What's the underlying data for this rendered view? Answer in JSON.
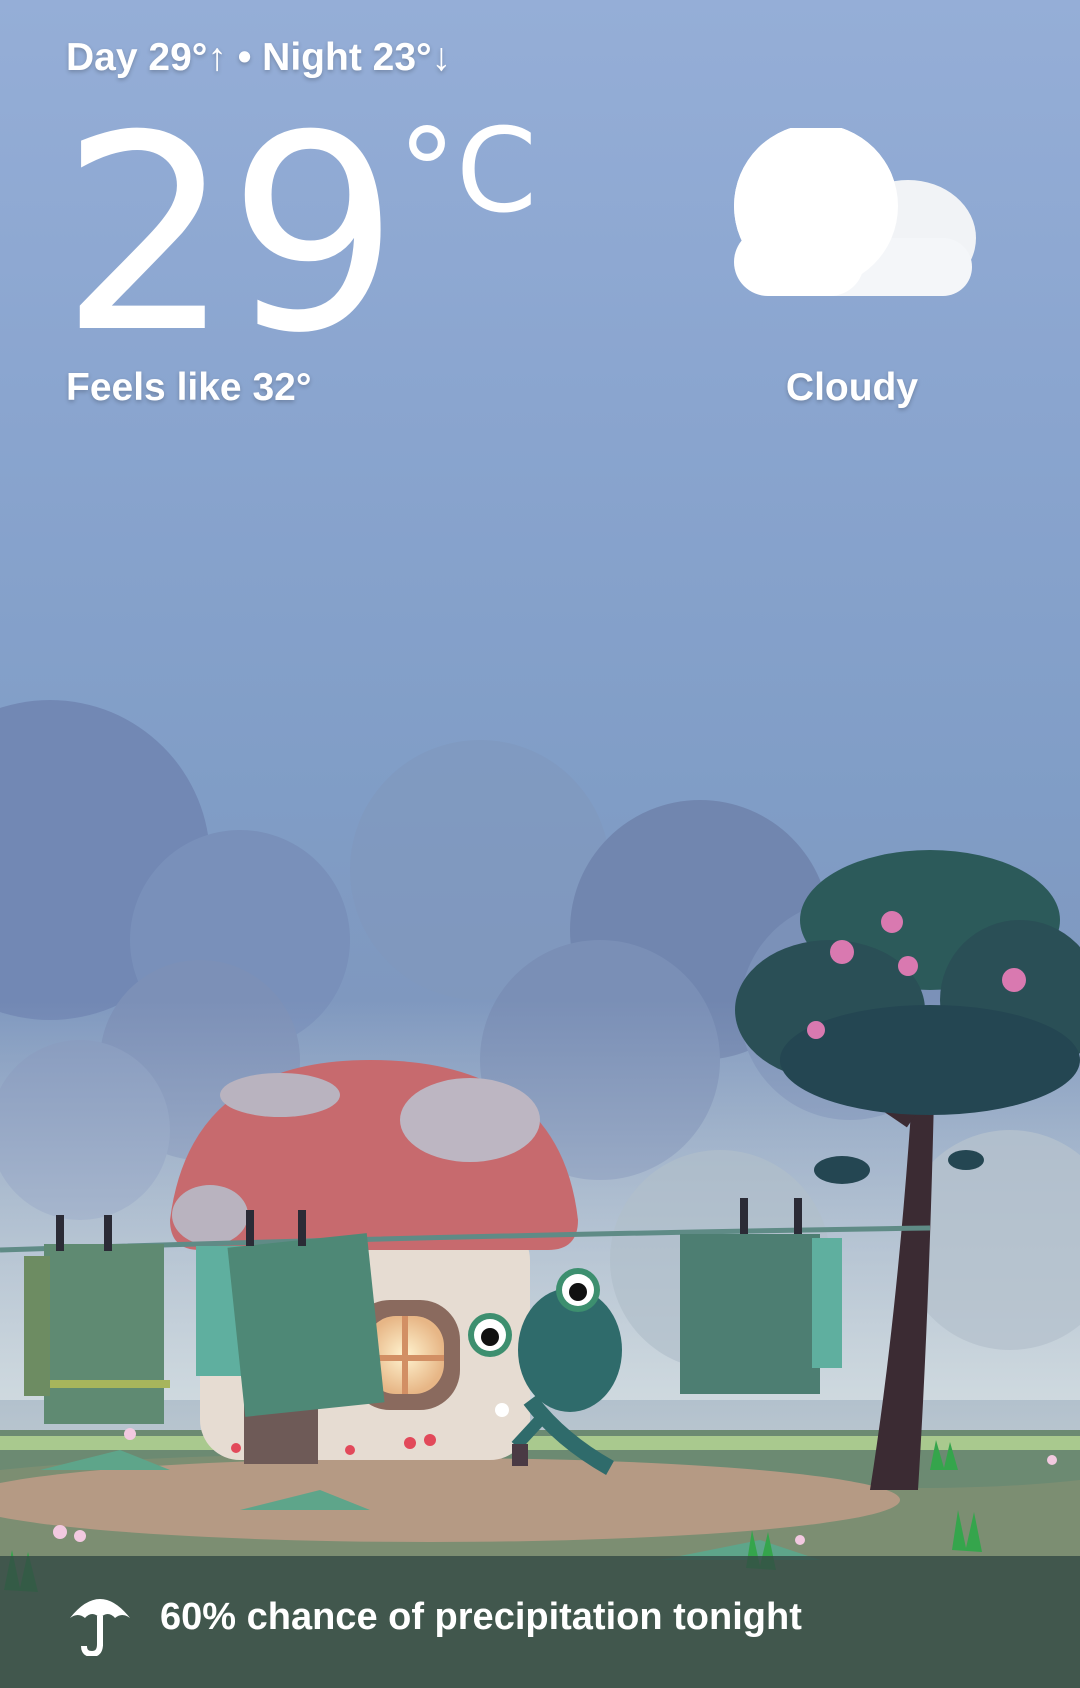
{
  "weather": {
    "day_night": "Day 29°↑ • Night 23°↓",
    "temperature": "29",
    "unit": "°C",
    "feels_like": "Feels like 32°",
    "condition": "Cloudy",
    "condition_icon": "cloud-icon"
  },
  "precipitation": {
    "text": "60% chance of precipitation tonight",
    "icon": "umbrella-icon"
  },
  "colors": {
    "sky_top": "#95aed7",
    "mushroom_cap": "#c76a6e",
    "frog": "#2f6b6b",
    "bottom_bar": "#344a46"
  }
}
